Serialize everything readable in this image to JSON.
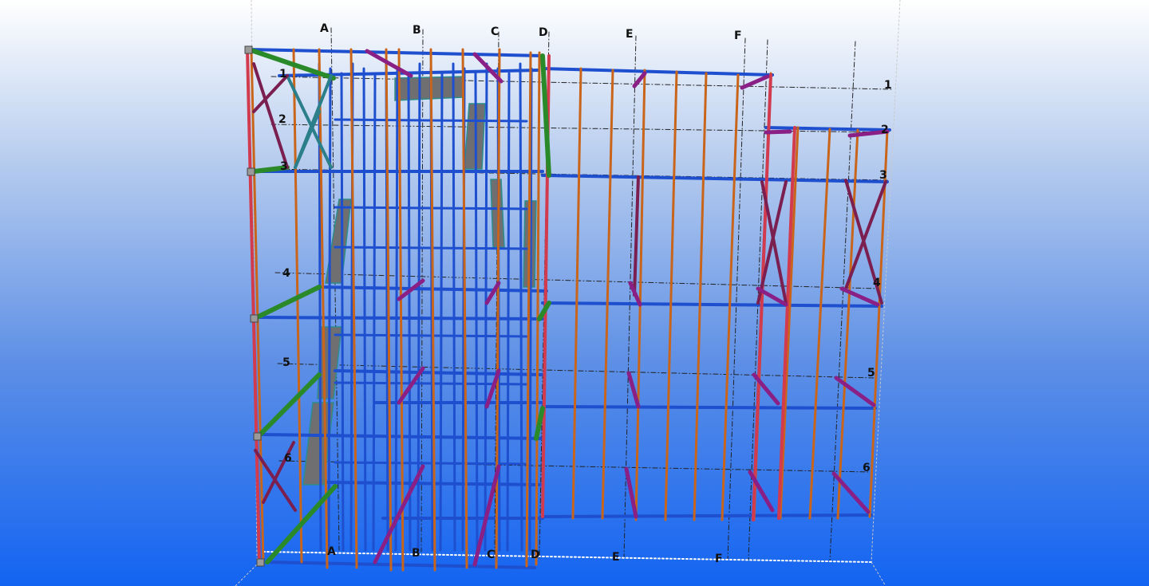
{
  "viewport": {
    "background_top": "#ffffff",
    "background_bottom": "#1364f2"
  },
  "grid_labels": {
    "top": [
      "A",
      "B",
      "C",
      "D",
      "E",
      "F"
    ],
    "bottom": [
      "A",
      "B",
      "C",
      "D",
      "E",
      "F"
    ],
    "left": [
      "1",
      "2",
      "3",
      "4",
      "5",
      "6"
    ],
    "right": [
      "1",
      "2",
      "3",
      "4",
      "5",
      "6"
    ]
  },
  "colors": {
    "beam": "#1e4fcf",
    "column": "#c9651a",
    "brace": "#7a1f4f",
    "kicker": "#8a1f86",
    "stringer": "#2a8a2a",
    "stair": "#6f6f72",
    "grid_line": "#222222"
  }
}
